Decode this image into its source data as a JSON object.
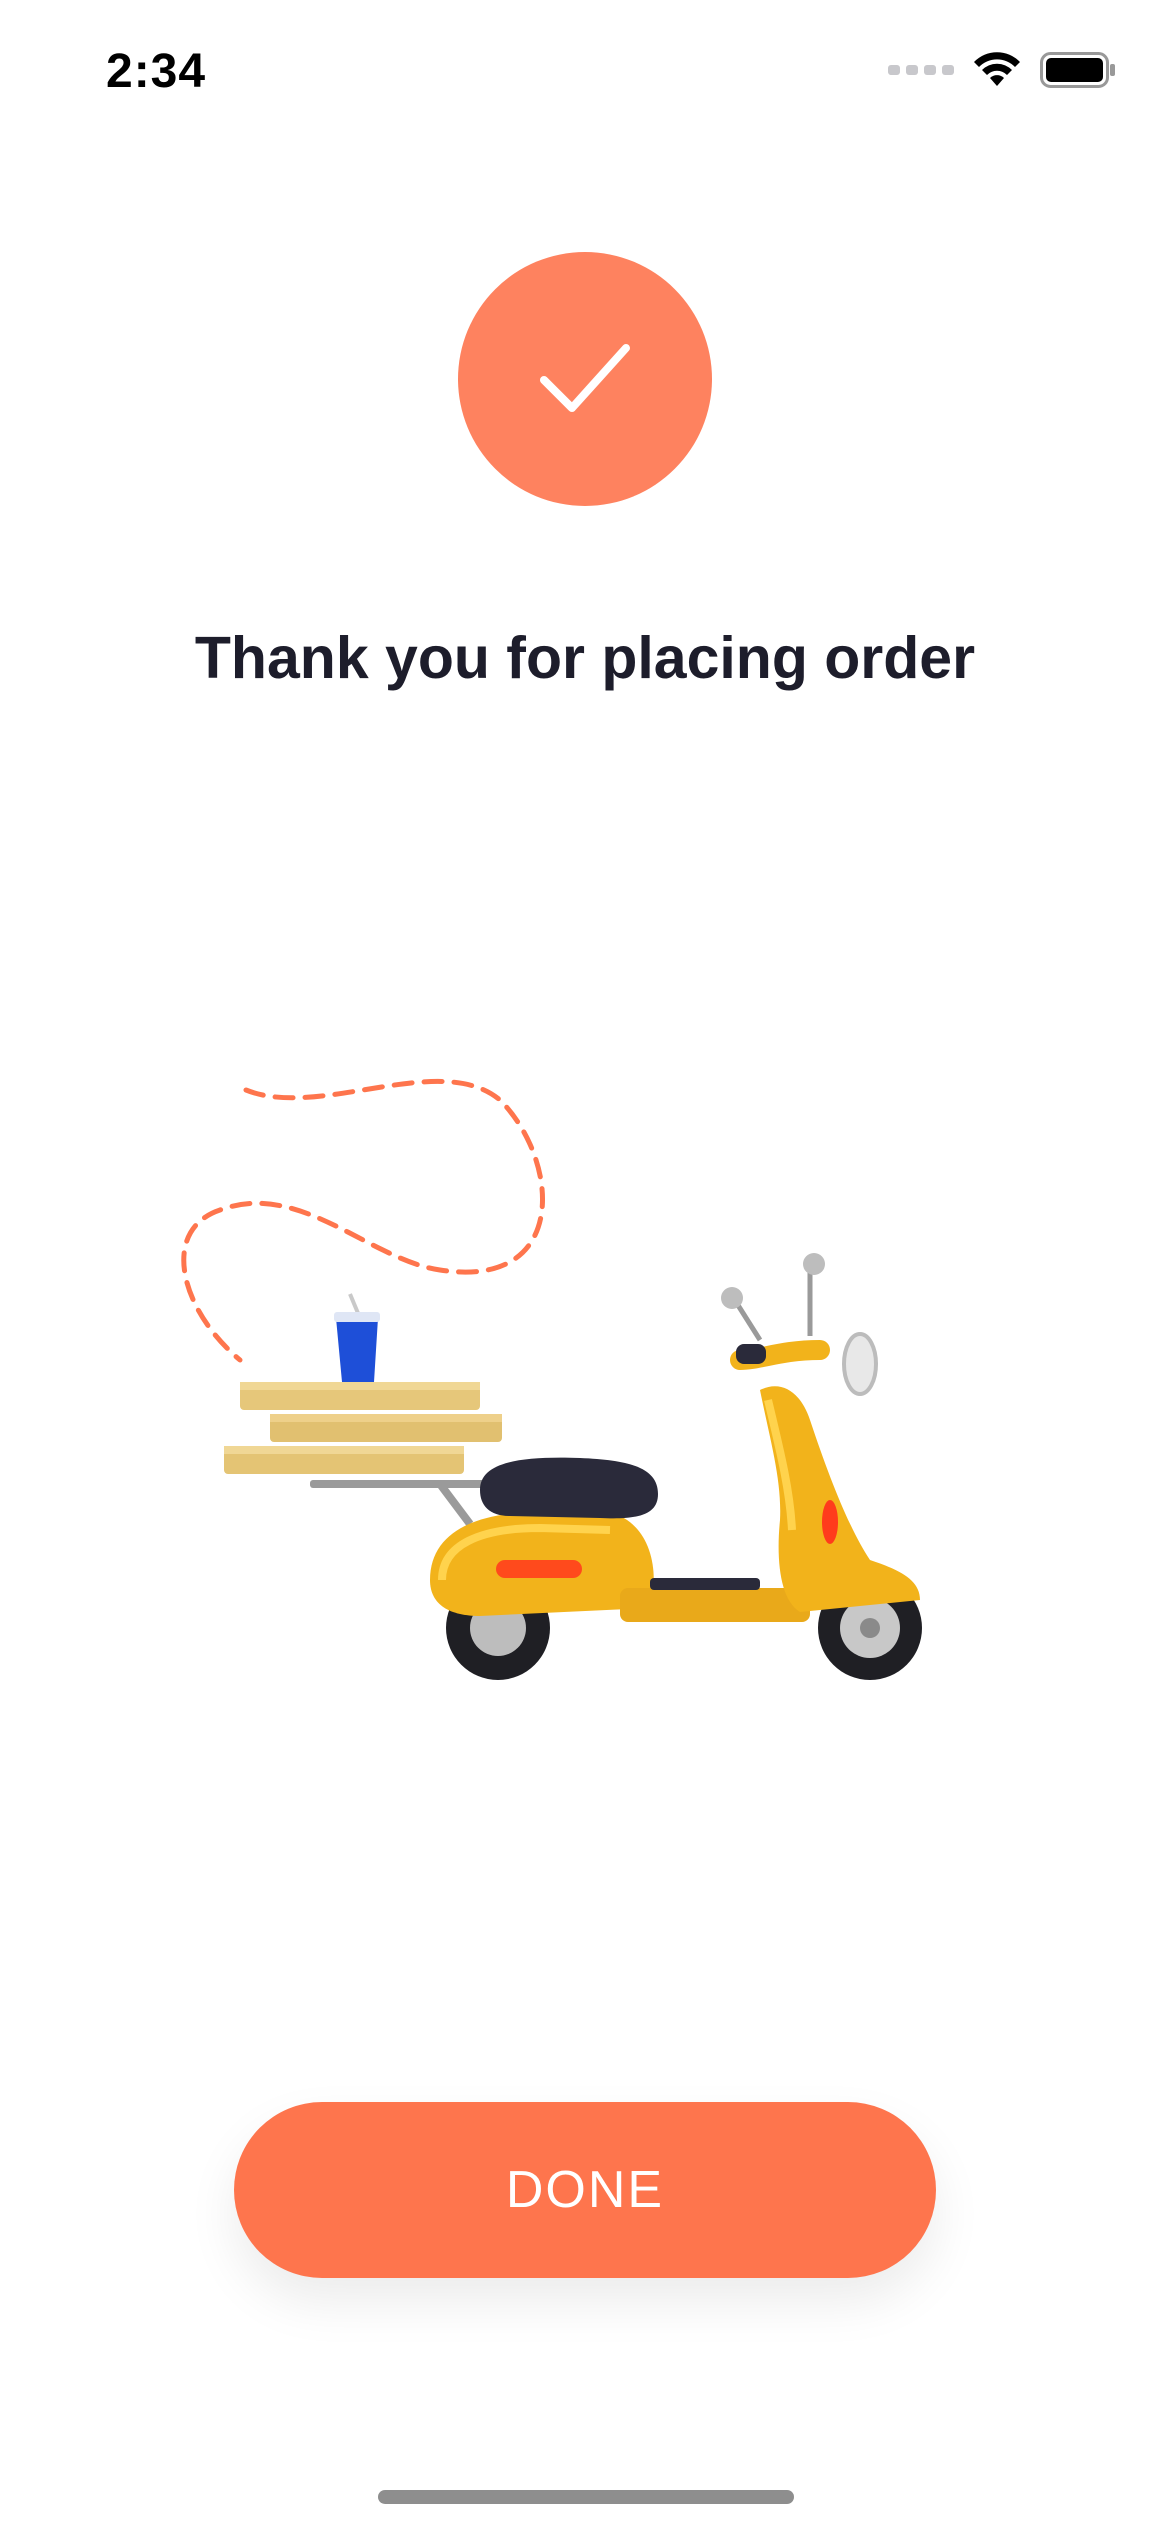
{
  "status_bar": {
    "time": "2:34",
    "icons": [
      "signal-icon",
      "wifi-icon",
      "battery-icon"
    ]
  },
  "confirmation": {
    "icon": "checkmark-icon",
    "title": "Thank you for placing order"
  },
  "illustration": {
    "name": "delivery-scooter-illustration"
  },
  "actions": {
    "done_label": "DONE"
  },
  "colors": {
    "accent": "#fe754d",
    "check_circle": "#fe825f",
    "title_text": "#1d1d2b",
    "background": "#ffffff"
  }
}
